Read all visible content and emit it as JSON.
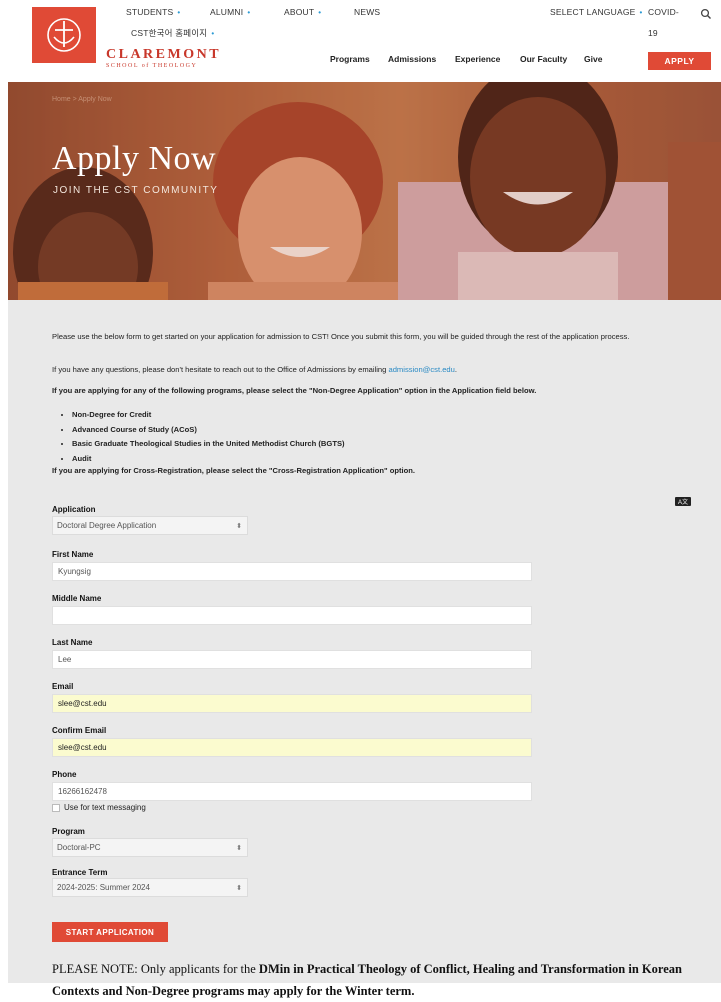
{
  "header": {
    "top_nav": [
      {
        "label": "STUDENTS",
        "has_dropdown": true
      },
      {
        "label": "ALUMNI",
        "has_dropdown": true
      },
      {
        "label": "ABOUT",
        "has_dropdown": true
      },
      {
        "label": "NEWS",
        "has_dropdown": false
      },
      {
        "label": "CST한국어 홈페이지",
        "has_dropdown": true
      }
    ],
    "language_label": "SELECT LANGUAGE",
    "covid_label_1": "COVID-",
    "covid_label_2": "19",
    "brand_line_1": "CLAREMONT",
    "brand_line_2": "SCHOOL of THEOLOGY",
    "main_nav": [
      "Programs",
      "Admissions",
      "Experience",
      "Our Faculty",
      "Give"
    ],
    "apply_label": "APPLY",
    "accent_color": "#e04a36",
    "icons": [
      "cross-anchor-logo-icon",
      "search-icon"
    ]
  },
  "hero": {
    "breadcrumb": "Home > Apply Now",
    "title": "Apply Now",
    "subtitle": "JOIN THE CST COMMUNITY"
  },
  "intro": {
    "p1": "Please use the below form to get started on your application for admission to CST! Once you submit this form, you will be guided through the rest of the application process.",
    "p2_before": "If you have any questions, please don't hesitate to reach out to the Office of Admissions by emailing ",
    "p2_link": "admission@cst.edu",
    "p2_after": ".",
    "p3": "If you are applying for any of the following programs, please select the \"Non-Degree Application\" option in the Application field below.",
    "bullets": [
      "Non-Degree for Credit",
      "Advanced Course of Study (ACoS)",
      "Basic Graduate Theological Studies in the United Methodist Church (BGTS)",
      "Audit"
    ],
    "p4": "If you are applying for Cross-Registration, please select the \"Cross-Registration Application\" option."
  },
  "form": {
    "application_label": "Application",
    "application_value": "Doctoral Degree Application",
    "first_name_label": "First Name",
    "first_name_value": "Kyungsig",
    "middle_name_label": "Middle Name",
    "middle_name_value": "",
    "last_name_label": "Last Name",
    "last_name_value": "Lee",
    "email_label": "Email",
    "email_value": "slee@cst.edu",
    "confirm_email_label": "Confirm Email",
    "confirm_email_value": "slee@cst.edu",
    "phone_label": "Phone",
    "phone_value": "16266162478",
    "sms_label": "Use for text messaging",
    "program_label": "Program",
    "program_value": "Doctoral-PC",
    "term_label": "Entrance Term",
    "term_value": "2024-2025: Summer 2024",
    "submit_label": "START APPLICATION"
  },
  "note": {
    "prefix": "PLEASE NOTE: Only applicants for the ",
    "bold1": "DMin in Practical Theology of Conflict, Healing and Transformation in Korean Contexts and Non-Degree programs may apply for the Winter term."
  }
}
